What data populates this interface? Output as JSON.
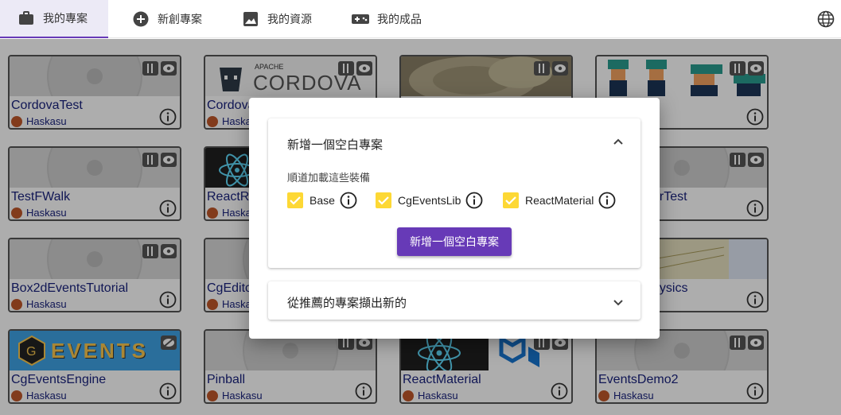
{
  "nav": {
    "tabs": [
      {
        "label": "我的專案",
        "icon": "briefcase-icon",
        "active": true
      },
      {
        "label": "新創專案",
        "icon": "plus-circle-icon"
      },
      {
        "label": "我的資源",
        "icon": "image-icon"
      },
      {
        "label": "我的成品",
        "icon": "gamepad-icon"
      }
    ],
    "language_icon": "globe-icon"
  },
  "projects": [
    {
      "name": "CordovaTest",
      "owner": "Haskasu"
    },
    {
      "name": "Cordova",
      "owner": "Haska"
    },
    {
      "name": "TestFWalk",
      "owner": "Haskasu"
    },
    {
      "name": "ReactR",
      "owner": "Haska"
    },
    {
      "name": "erTest",
      "owner": ""
    },
    {
      "name": "Box2dEventsTutorial",
      "owner": "Haskasu"
    },
    {
      "name": "CgEdito",
      "owner": "Haska"
    },
    {
      "name": "nysics",
      "owner": ""
    },
    {
      "name": "CgEventsEngine",
      "owner": "Haskasu"
    },
    {
      "name": "Pinball",
      "owner": "Haskasu"
    },
    {
      "name": "ReactMaterial",
      "owner": "Haskasu"
    },
    {
      "name": "EventsDemo2",
      "owner": "Haskasu"
    }
  ],
  "thumb_text": {
    "apache": "APACHE",
    "cordova": "CORDOVA",
    "events": "EVENTS"
  },
  "dialog": {
    "panel_blank": {
      "title": "新增一個空白專案",
      "subtitle": "順道加載這些裝備",
      "options": [
        "Base",
        "CgEventsLib",
        "ReactMaterial"
      ],
      "button": "新增一個空白專案"
    },
    "panel_recommended": {
      "title": "從推薦的專案擷出新的"
    }
  },
  "colors": {
    "accent": "#673ab7",
    "checkbox": "#fdd835",
    "link": "#1a237e"
  }
}
